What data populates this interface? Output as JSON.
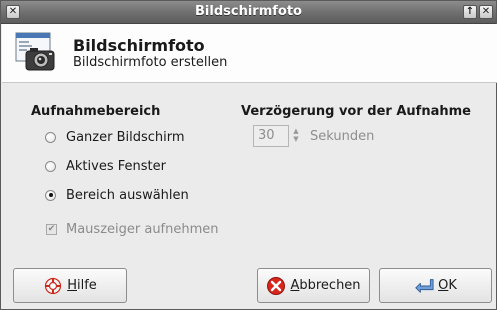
{
  "window": {
    "title": "Bildschirmfoto"
  },
  "header": {
    "title": "Bildschirmfoto",
    "subtitle": "Bildschirmfoto erstellen",
    "icon": "screenshot-camera-icon"
  },
  "capture_area": {
    "heading": "Aufnahmebereich",
    "options": [
      {
        "label": "Ganzer Bildschirm",
        "selected": false
      },
      {
        "label": "Aktives Fenster",
        "selected": false
      },
      {
        "label": "Bereich auswählen",
        "selected": true
      }
    ],
    "mouse_pointer": {
      "label": "Mauszeiger aufnehmen",
      "checked": true,
      "enabled": false
    }
  },
  "delay": {
    "heading": "Verzögerung vor der Aufnahme",
    "value": "30",
    "unit": "Sekunden",
    "enabled": false
  },
  "buttons": {
    "help_mnemonic": "H",
    "help_rest": "ilfe",
    "cancel_mnemonic": "A",
    "cancel_rest": "bbrechen",
    "ok_mnemonic": "O",
    "ok_rest": "K"
  }
}
